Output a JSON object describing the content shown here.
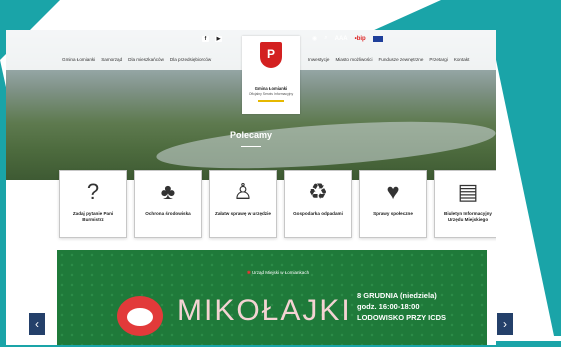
{
  "header": {
    "social": [
      "f",
      "▶"
    ],
    "tools": {
      "eye": "◉",
      "search": "⌕",
      "font": "AAA",
      "bip": "•bip"
    },
    "menu_left": [
      "Gmina Łomianki",
      "Samorząd",
      "Dla mieszkańców",
      "Dla przedsiębiorców"
    ],
    "menu_right": [
      "Inwestycje",
      "Miasto możliwości",
      "Fundusze zewnętrzne",
      "Przetargi",
      "Kontakt"
    ],
    "crest": {
      "name": "Gmina Łomianki",
      "sub": "Oficjalny Serwis Informacyjny"
    }
  },
  "hero": {
    "section_title": "Polecamy"
  },
  "cards": [
    {
      "icon": "?",
      "label": "Zadaj pytanie Pani Burmistrz"
    },
    {
      "icon": "♣",
      "label": "Ochrona środowiska"
    },
    {
      "icon": "♙",
      "label": "Załatw sprawę w urzędzie"
    },
    {
      "icon": "♻",
      "label": "Gospodarka odpadami"
    },
    {
      "icon": "♥",
      "label": "Sprawy społeczne"
    },
    {
      "icon": "▤",
      "label": "Biuletyn Informacyjny Urzędu Miejskiego"
    }
  ],
  "banner": {
    "logo": "Urząd Miejski w Łomiankach",
    "title": "MIKOŁAJKI",
    "date": "8 GRUDNIA (niedziela)",
    "time": "godz. 16:00-18:00",
    "place": "LODOWISKO PRZY ICDS"
  },
  "arrows": {
    "prev": "‹",
    "next": "›"
  }
}
